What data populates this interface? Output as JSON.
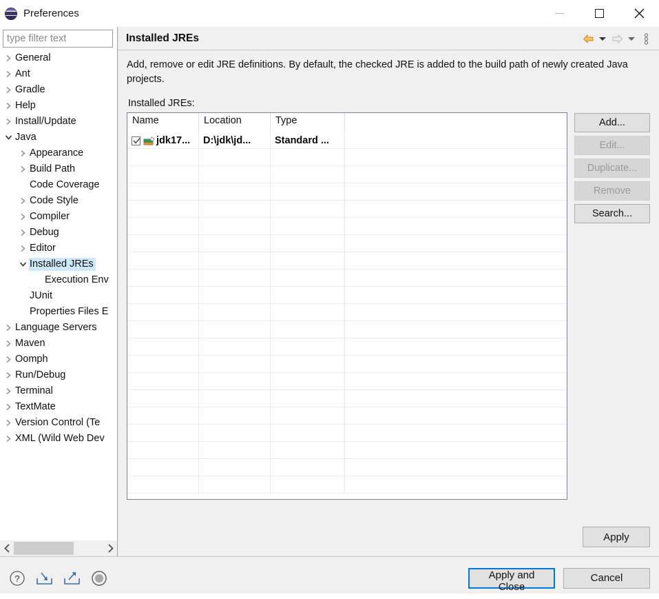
{
  "window": {
    "title": "Preferences",
    "icon": "eclipse-icon",
    "controls": {
      "minimize": "minimize-icon",
      "maximize": "maximize-icon",
      "close": "close-icon"
    }
  },
  "sidebar": {
    "filter": {
      "placeholder": "type filter text",
      "value": ""
    },
    "items": [
      {
        "label": "General",
        "level": 0,
        "twisty": "collapsed",
        "selected": false
      },
      {
        "label": "Ant",
        "level": 0,
        "twisty": "collapsed",
        "selected": false
      },
      {
        "label": "Gradle",
        "level": 0,
        "twisty": "collapsed",
        "selected": false
      },
      {
        "label": "Help",
        "level": 0,
        "twisty": "collapsed",
        "selected": false
      },
      {
        "label": "Install/Update",
        "level": 0,
        "twisty": "collapsed",
        "selected": false
      },
      {
        "label": "Java",
        "level": 0,
        "twisty": "expanded",
        "selected": false
      },
      {
        "label": "Appearance",
        "level": 1,
        "twisty": "collapsed",
        "selected": false
      },
      {
        "label": "Build Path",
        "level": 1,
        "twisty": "collapsed",
        "selected": false
      },
      {
        "label": "Code Coverage",
        "level": 1,
        "twisty": "none",
        "selected": false
      },
      {
        "label": "Code Style",
        "level": 1,
        "twisty": "collapsed",
        "selected": false
      },
      {
        "label": "Compiler",
        "level": 1,
        "twisty": "collapsed",
        "selected": false
      },
      {
        "label": "Debug",
        "level": 1,
        "twisty": "collapsed",
        "selected": false
      },
      {
        "label": "Editor",
        "level": 1,
        "twisty": "collapsed",
        "selected": false
      },
      {
        "label": "Installed JREs",
        "level": 1,
        "twisty": "expanded",
        "selected": true
      },
      {
        "label": "Execution Env",
        "level": 2,
        "twisty": "none",
        "selected": false
      },
      {
        "label": "JUnit",
        "level": 1,
        "twisty": "none",
        "selected": false
      },
      {
        "label": "Properties Files E",
        "level": 1,
        "twisty": "none",
        "selected": false
      },
      {
        "label": "Language Servers",
        "level": 0,
        "twisty": "collapsed",
        "selected": false
      },
      {
        "label": "Maven",
        "level": 0,
        "twisty": "collapsed",
        "selected": false
      },
      {
        "label": "Oomph",
        "level": 0,
        "twisty": "collapsed",
        "selected": false
      },
      {
        "label": "Run/Debug",
        "level": 0,
        "twisty": "collapsed",
        "selected": false
      },
      {
        "label": "Terminal",
        "level": 0,
        "twisty": "collapsed",
        "selected": false
      },
      {
        "label": "TextMate",
        "level": 0,
        "twisty": "collapsed",
        "selected": false
      },
      {
        "label": "Version Control (Te",
        "level": 0,
        "twisty": "collapsed",
        "selected": false
      },
      {
        "label": "XML (Wild Web Dev",
        "level": 0,
        "twisty": "collapsed",
        "selected": false
      }
    ],
    "scrollbar": {
      "left_arrow": "chevron-left-icon",
      "right_arrow": "chevron-right-icon"
    }
  },
  "content": {
    "title": "Installed JREs",
    "nav": {
      "back": "back-arrow-icon",
      "back_menu": "chevron-down-icon",
      "forward": "forward-arrow-icon",
      "forward_menu": "chevron-down-icon",
      "more": "view-menu-icon"
    },
    "description": "Add, remove or edit JRE definitions. By default, the checked JRE is added to the build path of newly created Java projects.",
    "table_label": "Installed JREs:",
    "table": {
      "columns": [
        "Name",
        "Location",
        "Type",
        ""
      ],
      "rows": [
        {
          "checked": true,
          "icon": "jre-library-icon",
          "name": "jdk17...",
          "location": "D:\\jdk\\jd...",
          "type": "Standard ..."
        }
      ],
      "empty_row_count": 20
    },
    "buttons": [
      {
        "label": "Add...",
        "enabled": true
      },
      {
        "label": "Edit...",
        "enabled": false
      },
      {
        "label": "Duplicate...",
        "enabled": false
      },
      {
        "label": "Remove",
        "enabled": false
      },
      {
        "label": "Search...",
        "enabled": true
      }
    ],
    "apply_label": "Apply"
  },
  "footer": {
    "icons": [
      {
        "name": "help-icon"
      },
      {
        "name": "import-icon"
      },
      {
        "name": "export-icon"
      },
      {
        "name": "oomph-recorder-icon"
      }
    ],
    "apply_and_close_label": "Apply and Close",
    "cancel_label": "Cancel"
  },
  "colors": {
    "selection": "#cde8f7",
    "focus_border": "#0078d7",
    "dialog_bg": "#f0f0f0",
    "nav_back_arrow": "#e8a33d"
  }
}
